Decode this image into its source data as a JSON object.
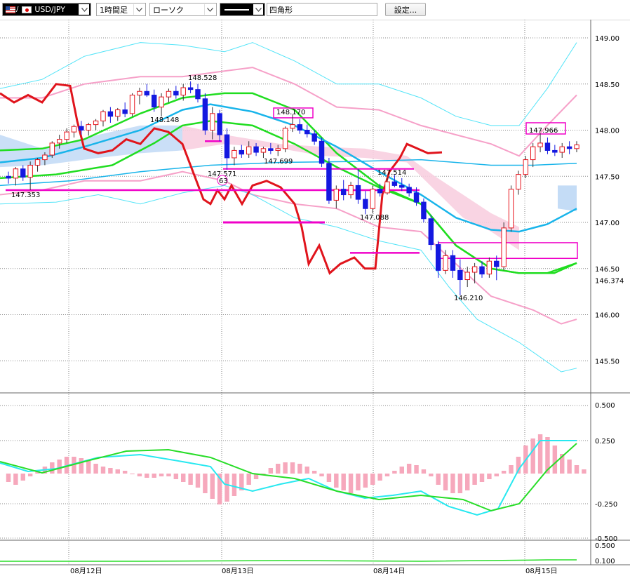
{
  "toolbar": {
    "symbol": "USD/JPY",
    "timeframe": "1時間足",
    "chart_style": "ローソク",
    "line_width_label": "",
    "drawing_tool": "四角形",
    "settings_button": "設定..."
  },
  "colors": {
    "bull_candle": "#e8141c",
    "bear_candle": "#1418e0",
    "bollinger_outer": "#52e4f8",
    "bollinger_inner": "#f6a0c8",
    "ma_short": "#20dd20",
    "ma_mid": "#18b4ea",
    "ichimoku_span": "#e0141c",
    "annotation": "#f000c8",
    "macd_hist_pos": "#f6a8bc",
    "macd_line": "#28e8f0",
    "signal_line": "#28dd28"
  },
  "chart_data": {
    "type": "candlestick",
    "price_axis": {
      "ticks": [
        "149.00",
        "148.50",
        "148.00",
        "147.50",
        "147.00",
        "146.50",
        "146.00",
        "145.50"
      ],
      "current": "146.374"
    },
    "macd_axis": {
      "ticks": [
        "0.500",
        "0.250",
        "-0.250",
        "-0.500"
      ]
    },
    "rsi_axis": {
      "ticks": [
        "0.500",
        "0.100"
      ]
    },
    "x_ticks": [
      "08月12日",
      "08月13日",
      "08月14日",
      "08月15日"
    ],
    "annotations": [
      {
        "label": "148.528"
      },
      {
        "label": "148.148"
      },
      {
        "label": "147.353"
      },
      {
        "label": "147.571"
      },
      {
        "label": "147.699"
      },
      {
        "label": "148.170"
      },
      {
        "label": "147.514"
      },
      {
        "label": "147.088"
      },
      {
        "label": "146.210"
      },
      {
        "label": "147.966"
      }
    ],
    "circle_label": "63",
    "candles_hourly": [
      [
        147.5,
        147.55,
        147.42,
        147.48
      ],
      [
        147.48,
        147.6,
        147.4,
        147.58
      ],
      [
        147.58,
        147.62,
        147.45,
        147.49
      ],
      [
        147.49,
        147.66,
        147.35,
        147.62
      ],
      [
        147.62,
        147.7,
        147.55,
        147.68
      ],
      [
        147.68,
        147.76,
        147.62,
        147.73
      ],
      [
        147.73,
        147.88,
        147.7,
        147.86
      ],
      [
        147.86,
        147.95,
        147.8,
        147.9
      ],
      [
        147.9,
        148.02,
        147.86,
        147.98
      ],
      [
        147.98,
        148.06,
        147.92,
        148.04
      ],
      [
        148.04,
        148.1,
        147.95,
        148.0
      ],
      [
        148.0,
        148.08,
        147.94,
        148.06
      ],
      [
        148.06,
        148.12,
        148.0,
        148.1
      ],
      [
        148.1,
        148.22,
        148.04,
        148.2
      ],
      [
        148.2,
        148.25,
        148.08,
        148.15
      ],
      [
        148.15,
        148.24,
        148.1,
        148.22
      ],
      [
        148.22,
        148.3,
        148.14,
        148.18
      ],
      [
        148.18,
        148.4,
        148.15,
        148.38
      ],
      [
        148.38,
        148.46,
        148.28,
        148.42
      ],
      [
        148.42,
        148.5,
        148.36,
        148.38
      ],
      [
        148.38,
        148.44,
        148.2,
        148.25
      ],
      [
        148.25,
        148.4,
        148.148,
        148.36
      ],
      [
        148.36,
        148.45,
        148.3,
        148.42
      ],
      [
        148.42,
        148.48,
        148.34,
        148.38
      ],
      [
        148.38,
        148.5,
        148.32,
        148.46
      ],
      [
        148.46,
        148.528,
        148.4,
        148.44
      ],
      [
        148.44,
        148.5,
        148.3,
        148.34
      ],
      [
        148.34,
        148.4,
        147.95,
        148.0
      ],
      [
        148.0,
        148.25,
        147.9,
        148.18
      ],
      [
        148.18,
        148.22,
        147.88,
        147.95
      ],
      [
        147.95,
        148.02,
        147.571,
        147.7
      ],
      [
        147.7,
        147.82,
        147.62,
        147.78
      ],
      [
        147.78,
        147.84,
        147.7,
        147.74
      ],
      [
        147.74,
        147.88,
        147.7,
        147.82
      ],
      [
        147.82,
        147.86,
        147.72,
        147.76
      ],
      [
        147.76,
        147.82,
        147.699,
        147.8
      ],
      [
        147.8,
        147.86,
        147.74,
        147.78
      ],
      [
        147.78,
        147.84,
        147.72,
        147.8
      ],
      [
        147.8,
        148.04,
        147.76,
        148.02
      ],
      [
        148.02,
        148.17,
        147.98,
        148.06
      ],
      [
        148.06,
        148.12,
        147.96,
        148.0
      ],
      [
        148.0,
        148.06,
        147.92,
        147.96
      ],
      [
        147.96,
        148.0,
        147.84,
        147.88
      ],
      [
        147.88,
        147.92,
        147.6,
        147.64
      ],
      [
        147.64,
        147.7,
        147.2,
        147.24
      ],
      [
        147.24,
        147.4,
        147.15,
        147.36
      ],
      [
        147.36,
        147.46,
        147.24,
        147.3
      ],
      [
        147.3,
        147.44,
        147.26,
        147.4
      ],
      [
        147.4,
        147.58,
        147.2,
        147.25
      ],
      [
        147.25,
        147.34,
        147.088,
        147.15
      ],
      [
        147.15,
        147.4,
        147.1,
        147.36
      ],
      [
        147.36,
        147.42,
        147.28,
        147.32
      ],
      [
        147.32,
        147.48,
        147.3,
        147.44
      ],
      [
        147.44,
        147.514,
        147.38,
        147.4
      ],
      [
        147.4,
        147.48,
        147.34,
        147.38
      ],
      [
        147.38,
        147.42,
        147.28,
        147.32
      ],
      [
        147.32,
        147.38,
        147.18,
        147.22
      ],
      [
        147.22,
        147.26,
        147.0,
        147.04
      ],
      [
        147.04,
        147.08,
        146.7,
        146.76
      ],
      [
        146.76,
        146.8,
        146.4,
        146.48
      ],
      [
        146.48,
        146.7,
        146.44,
        146.64
      ],
      [
        146.64,
        146.7,
        146.4,
        146.48
      ],
      [
        146.48,
        146.6,
        146.21,
        146.38
      ],
      [
        146.38,
        146.52,
        146.3,
        146.46
      ],
      [
        146.46,
        146.56,
        146.34,
        146.52
      ],
      [
        146.52,
        146.58,
        146.4,
        146.44
      ],
      [
        146.44,
        146.62,
        146.4,
        146.58
      ],
      [
        146.58,
        146.64,
        146.374,
        146.52
      ],
      [
        146.52,
        147.0,
        146.48,
        146.94
      ],
      [
        146.94,
        147.4,
        146.9,
        147.36
      ],
      [
        147.36,
        147.56,
        147.3,
        147.52
      ],
      [
        147.52,
        147.72,
        147.48,
        147.68
      ],
      [
        147.68,
        147.86,
        147.6,
        147.82
      ],
      [
        147.82,
        147.966,
        147.76,
        147.86
      ],
      [
        147.86,
        147.92,
        147.74,
        147.78
      ],
      [
        147.78,
        147.84,
        147.72,
        147.76
      ],
      [
        147.76,
        147.86,
        147.7,
        147.82
      ],
      [
        147.82,
        147.88,
        147.74,
        147.8
      ],
      [
        147.8,
        147.88,
        147.76,
        147.84
      ]
    ],
    "macd_histogram": [
      -0.06,
      -0.08,
      -0.05,
      -0.02,
      0.02,
      0.05,
      0.08,
      0.1,
      0.12,
      0.12,
      0.11,
      0.09,
      0.07,
      0.05,
      0.04,
      0.03,
      0.02,
      0.0,
      -0.02,
      -0.03,
      -0.03,
      -0.02,
      -0.02,
      -0.04,
      -0.06,
      -0.08,
      -0.1,
      -0.14,
      -0.18,
      -0.22,
      -0.2,
      -0.16,
      -0.12,
      -0.08,
      -0.04,
      0.0,
      0.04,
      0.07,
      0.08,
      0.08,
      0.07,
      0.05,
      0.02,
      -0.02,
      -0.06,
      -0.1,
      -0.12,
      -0.14,
      -0.12,
      -0.1,
      -0.08,
      -0.05,
      -0.02,
      0.02,
      0.05,
      0.07,
      0.06,
      0.03,
      -0.02,
      -0.08,
      -0.12,
      -0.14,
      -0.14,
      -0.12,
      -0.08,
      -0.06,
      -0.04,
      -0.02,
      0.02,
      0.06,
      0.12,
      0.2,
      0.25,
      0.28,
      0.26,
      0.2,
      0.14,
      0.1,
      0.06,
      0.03
    ]
  }
}
